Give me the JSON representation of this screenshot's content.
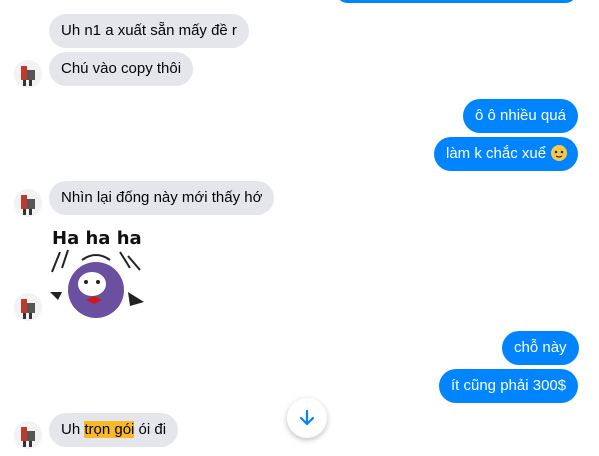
{
  "messages": {
    "m1": "Uh n1 a xuất sẵn mấy đề r",
    "m2": "Chú vào copy thôi",
    "m3": "ô ô nhiều quá",
    "m4": "làm k chắc xuể",
    "m5": "Nhìn lại đống này mới thấy hớ",
    "m6": "chỗ này",
    "m7": "ít cũng phải 300$",
    "m8_pre": "Uh ",
    "m8_highlight": "trọn gói",
    "m8_post": " ói đi"
  },
  "sticker": {
    "text": "Ha ha ha"
  },
  "colors": {
    "outgoing": "#0084ff",
    "incoming": "#e4e6eb",
    "highlight": "#f6b928"
  },
  "icons": {
    "scroll_down": "arrow-down-icon",
    "emoji": "face-emoji-icon"
  }
}
